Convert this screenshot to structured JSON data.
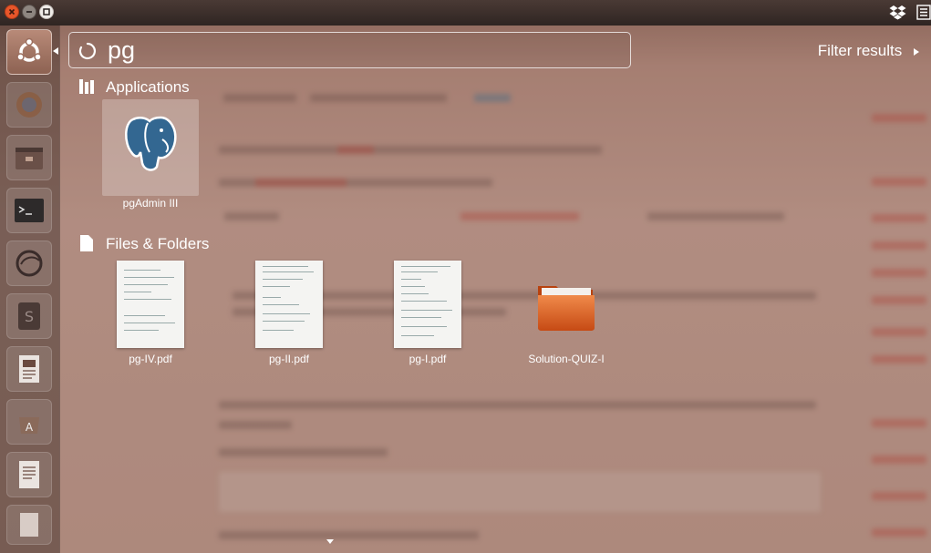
{
  "search": {
    "query": "pg"
  },
  "filter": {
    "label": "Filter results"
  },
  "sections": {
    "applications": {
      "header": "Applications",
      "items": [
        {
          "label": "pgAdmin III",
          "icon": "postgres-elephant-icon"
        }
      ]
    },
    "files": {
      "header": "Files & Folders",
      "items": [
        {
          "label": "pg-IV.pdf",
          "icon": "pdf-thumbnail-icon"
        },
        {
          "label": "pg-II.pdf",
          "icon": "pdf-thumbnail-icon"
        },
        {
          "label": "pg-I.pdf",
          "icon": "pdf-thumbnail-icon"
        },
        {
          "label": "Solution-QUIZ-I",
          "icon": "folder-icon"
        }
      ]
    }
  },
  "launcher": {
    "items": [
      "ubuntu-dash-icon",
      "firefox-icon",
      "files-icon",
      "terminal-icon",
      "eclipse-icon",
      "sublime-icon",
      "libreoffice-impress-icon",
      "software-center-icon",
      "libreoffice-writer-icon"
    ]
  },
  "colors": {
    "accent": "#e95420",
    "folder": "#e0601e",
    "text": "#ffffff"
  }
}
